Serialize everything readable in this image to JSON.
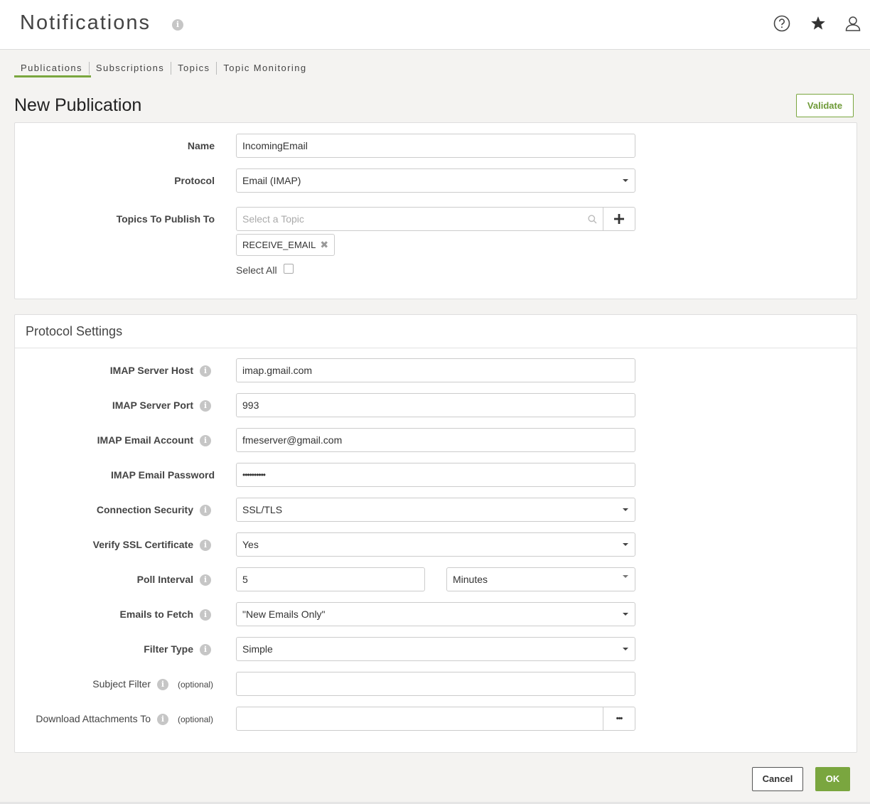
{
  "header": {
    "app_title": "Notifications",
    "info_icon": "info-icon",
    "icons": [
      "help-circle-icon",
      "star-icon",
      "user-icon"
    ]
  },
  "tabs": [
    {
      "label": "Publications",
      "active": true
    },
    {
      "label": "Subscriptions",
      "active": false
    },
    {
      "label": "Topics",
      "active": false
    },
    {
      "label": "Topic Monitoring",
      "active": false
    }
  ],
  "page": {
    "title": "New Publication",
    "validate_label": "Validate"
  },
  "general": {
    "name_label": "Name",
    "name_value": "IncomingEmail",
    "protocol_label": "Protocol",
    "protocol_value": "Email (IMAP)",
    "topics_label": "Topics To Publish To",
    "topics_placeholder": "Select a Topic",
    "add_icon": "plus-icon",
    "selected_topic": "RECEIVE_EMAIL",
    "remove_icon": "close-icon",
    "select_all_label": "Select All",
    "select_all_checked": false
  },
  "protocol_settings": {
    "title": "Protocol Settings",
    "host_label": "IMAP Server Host",
    "host_value": "imap.gmail.com",
    "port_label": "IMAP Server Port",
    "port_value": "993",
    "account_label": "IMAP Email Account",
    "account_value": "fmeserver@gmail.com",
    "password_label": "IMAP Email Password",
    "password_value": "••••••••••",
    "security_label": "Connection Security",
    "security_value": "SSL/TLS",
    "verify_label": "Verify SSL Certificate",
    "verify_value": "Yes",
    "poll_label": "Poll Interval",
    "poll_value": "5",
    "poll_unit": "Minutes",
    "fetch_label": "Emails to Fetch",
    "fetch_value": "\"New Emails Only\"",
    "filter_label": "Filter Type",
    "filter_value": "Simple",
    "subject_label": "Subject Filter",
    "subject_optional": "(optional)",
    "subject_value": "",
    "download_label": "Download Attachments To",
    "download_optional": "(optional)",
    "download_value": "",
    "browse_label": "•••"
  },
  "footer": {
    "cancel_label": "Cancel",
    "ok_label": "OK"
  },
  "colors": {
    "accent": "#7aa63f",
    "background": "#f4f3f1"
  }
}
